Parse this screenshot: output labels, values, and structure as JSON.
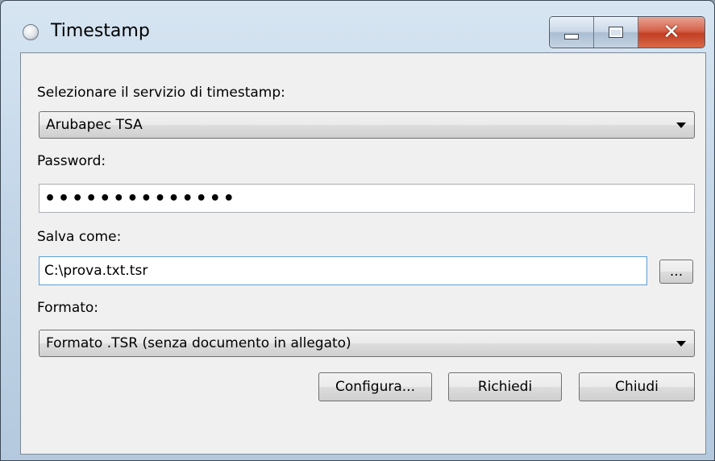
{
  "window": {
    "title": "Timestamp",
    "icon": "clock-icon",
    "controls": {
      "minimize": "minimize-icon",
      "maximize": "maximize-icon",
      "close": "close-icon"
    }
  },
  "form": {
    "service_label": "Selezionare il servizio di timestamp:",
    "service_selected": "Arubapec TSA",
    "password_label": "Password:",
    "password_masked": "••••••••••••••",
    "save_as_label": "Salva come:",
    "save_as_value": "C:\\prova.txt.tsr",
    "browse_label": "...",
    "format_label": "Formato:",
    "format_selected": "Formato .TSR (senza documento in allegato)"
  },
  "buttons": {
    "configure": "Configura...",
    "request": "Richiedi",
    "close": "Chiudi"
  }
}
